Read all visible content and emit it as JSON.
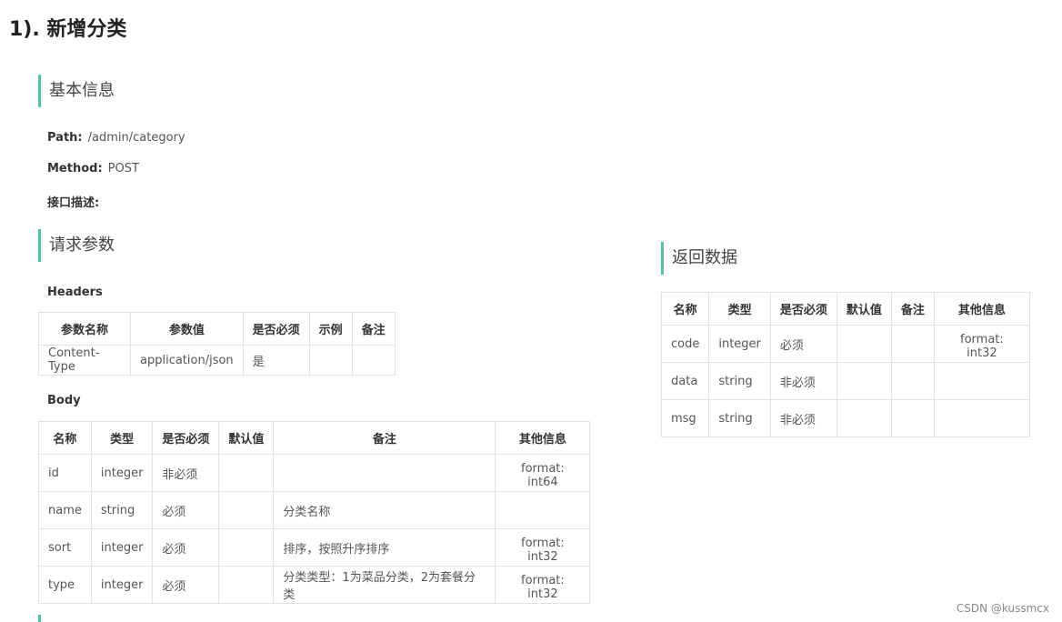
{
  "title": "1). 新增分类",
  "basic_info": {
    "heading": "基本信息",
    "path_label": "Path:",
    "path_value": "/admin/category",
    "method_label": "Method:",
    "method_value": "POST",
    "desc_label": "接口描述:"
  },
  "request": {
    "heading": "请求参数",
    "headers_label": "Headers",
    "headers_table": {
      "columns": [
        "参数名称",
        "参数值",
        "是否必须",
        "示例",
        "备注"
      ],
      "rows": [
        [
          "Content-Type",
          "application/json",
          "是",
          "",
          ""
        ]
      ]
    },
    "body_label": "Body",
    "body_table": {
      "columns": [
        "名称",
        "类型",
        "是否必须",
        "默认值",
        "备注",
        "其他信息"
      ],
      "rows": [
        [
          "id",
          "integer",
          "非必须",
          "",
          "",
          "format: int64"
        ],
        [
          "name",
          "string",
          "必须",
          "",
          "分类名称",
          ""
        ],
        [
          "sort",
          "integer",
          "必须",
          "",
          "排序，按照升序排序",
          "format: int32"
        ],
        [
          "type",
          "integer",
          "必须",
          "",
          "分类类型：1为菜品分类，2为套餐分类",
          "format: int32"
        ]
      ]
    }
  },
  "response": {
    "heading": "返回数据",
    "table": {
      "columns": [
        "名称",
        "类型",
        "是否必须",
        "默认值",
        "备注",
        "其他信息"
      ],
      "rows": [
        [
          "code",
          "integer",
          "必须",
          "",
          "",
          "format: int32"
        ],
        [
          "data",
          "string",
          "非必须",
          "",
          "",
          ""
        ],
        [
          "msg",
          "string",
          "非必须",
          "",
          "",
          ""
        ]
      ]
    }
  },
  "watermark": "CSDN @kussmcx",
  "colors": {
    "accent": "#4dc89a",
    "border": "#e1e1e1"
  }
}
